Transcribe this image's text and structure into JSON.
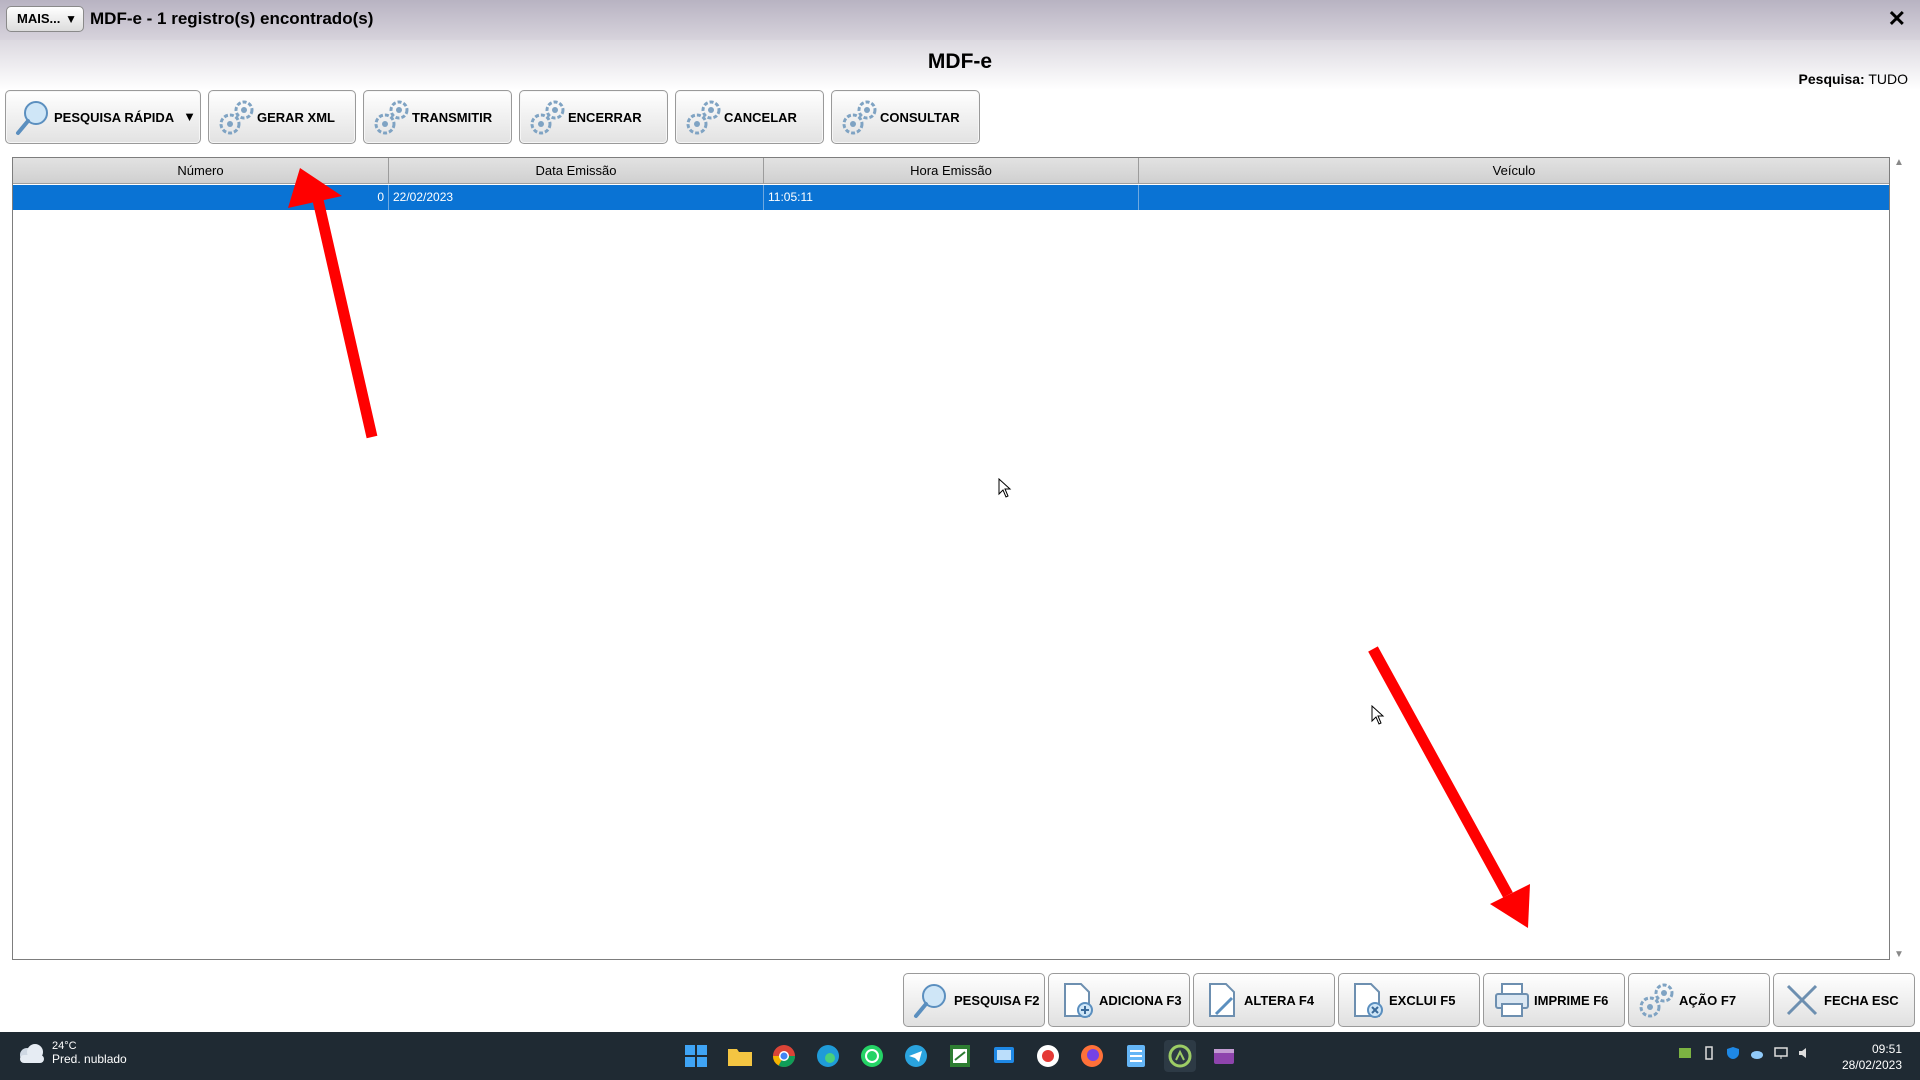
{
  "titlebar": {
    "mais_label": "MAIS...",
    "title": "MDF-e - 1 registro(s) encontrado(s)",
    "close_label": "✕"
  },
  "header": {
    "title": "MDF-e",
    "search_mode_label": "Pesquisa:",
    "search_mode_value": "TUDO"
  },
  "toolbar": {
    "pesquisa_rapida": "PESQUISA RÁPIDA",
    "gerar_xml": "GERAR XML",
    "transmitir": "TRANSMITIR",
    "encerrar": "ENCERRAR",
    "cancelar": "CANCELAR",
    "consultar": "CONSULTAR"
  },
  "grid": {
    "columns": [
      "Número",
      "Data Emissão",
      "Hora Emissão",
      "Veículo"
    ],
    "rows": [
      {
        "numero": "0",
        "data": "22/02/2023",
        "hora": "11:05:11",
        "veiculo": ""
      }
    ]
  },
  "footer": {
    "pesquisa": "PESQUISA F2",
    "adiciona": "ADICIONA F3",
    "altera": "ALTERA F4",
    "exclui": "EXCLUI F5",
    "imprime": "IMPRIME F6",
    "acao": "AÇÃO F7",
    "fecha": "FECHA ESC"
  },
  "taskbar": {
    "temperature": "24°C",
    "condition": "Pred. nublado",
    "time": "09:51",
    "date": "28/02/2023",
    "apps": [
      "start-icon",
      "file-explorer-icon",
      "chrome-icon",
      "edge-icon",
      "whatsapp-icon",
      "telegram-icon",
      "spreadsheet-icon",
      "remote-icon",
      "app-icon",
      "firefox-icon",
      "notepad-icon",
      "erp-icon",
      "video-editor-icon"
    ]
  },
  "colors": {
    "selection": "#0a73d4",
    "arrow": "#ff0000",
    "taskbar": "#1f2a33"
  }
}
